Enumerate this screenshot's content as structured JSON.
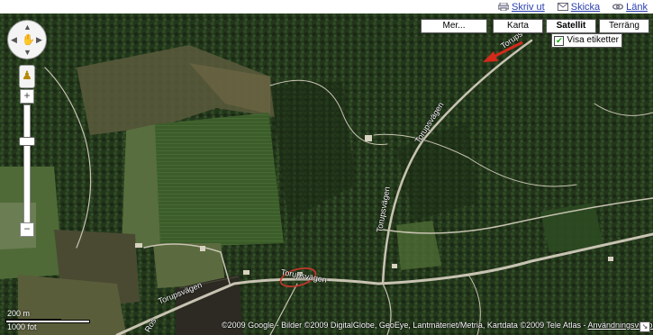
{
  "toplinks": [
    {
      "label": "Skriv ut",
      "icon": "print-icon"
    },
    {
      "label": "Skicka",
      "icon": "envelope-icon"
    },
    {
      "label": "Länk",
      "icon": "link-icon"
    }
  ],
  "map_types": {
    "more": "Mer...",
    "map": "Karta",
    "satellite": "Satellit",
    "terrain": "Terräng",
    "active": "Satellit"
  },
  "labels_toggle": {
    "label": "Visa etiketter",
    "checked": true
  },
  "road_labels": [
    "Torups",
    "Torupsvägen",
    "Torupsvägen",
    "Torupsvägen",
    "Torupsvägen",
    "Ros"
  ],
  "zoom": {
    "plus": "+",
    "minus": "−"
  },
  "scale": {
    "metric": "200 m",
    "imperial": "1000 fot"
  },
  "copyright": {
    "text": "©2009 Google - Bilder ©2009 DigitalGlobe, GeoEye, Lantmäteriet/Metria, Kartdata ©2009 Tele Atlas - ",
    "terms": "Användningsvillkor"
  },
  "colors": {
    "forest": "#24351c",
    "field": "#3d5a2c",
    "road": "#c8c3b2",
    "marker": "#c0392b",
    "link": "#2a3fb0"
  }
}
